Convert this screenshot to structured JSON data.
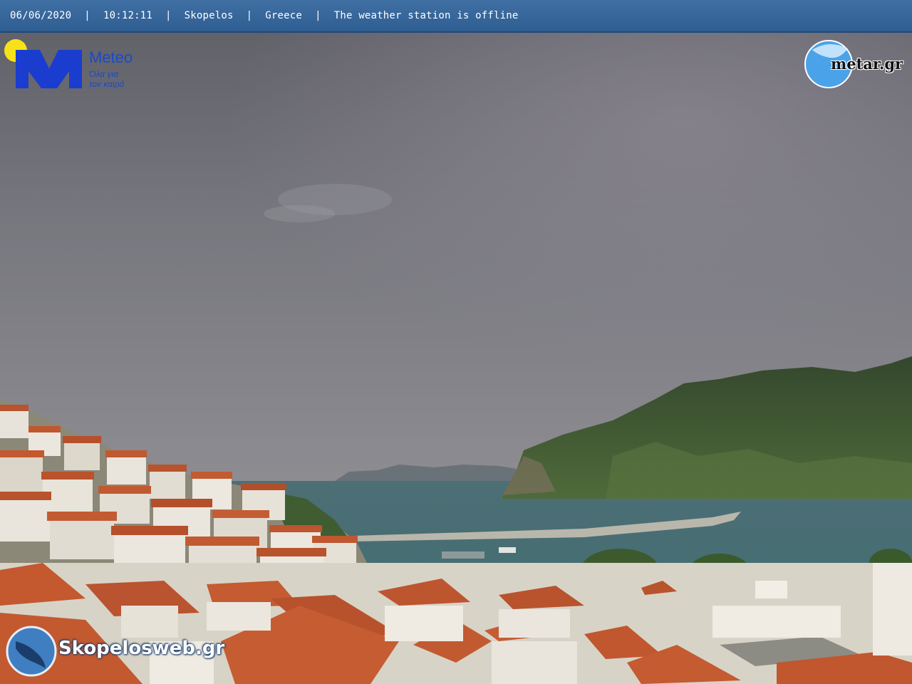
{
  "overlay": {
    "date": "06/06/2020",
    "time": "10:12:11",
    "location": "Skopelos",
    "country": "Greece",
    "status": "The weather station is offline",
    "separator": "|"
  },
  "logos": {
    "meteo_name": "Meteo",
    "meteo_tagline_1": "Όλα για",
    "meteo_tagline_2": "τον καιρό",
    "metar": "metar.gr",
    "skopelosweb": "Skopelosweb.gr"
  },
  "colors": {
    "bar_blue": "#2f5e93",
    "meteo_blue": "#1a4ac8",
    "sea": "#3f6e72",
    "roof": "#c2542c",
    "hill": "#3f5a34"
  }
}
